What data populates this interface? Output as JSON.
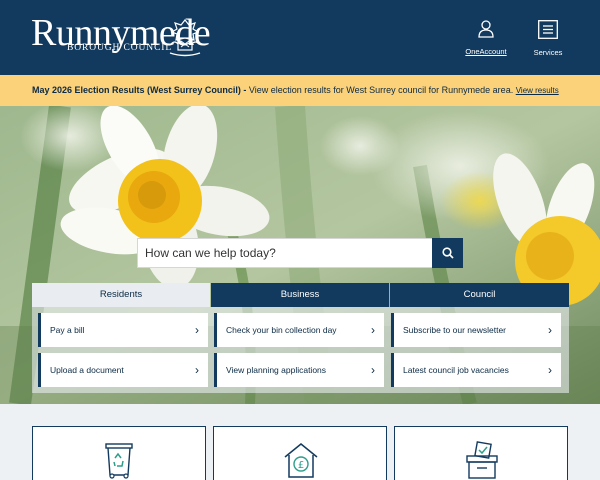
{
  "header": {
    "logo_title": "Runnymede",
    "logo_subtitle": "BOROUGH COUNCIL",
    "nav": [
      {
        "label": "OneAccount",
        "icon": "user-icon"
      },
      {
        "label": "Services",
        "icon": "menu-icon"
      }
    ]
  },
  "banner": {
    "title": "May 2026 Election Results (West Surrey Council) -",
    "text": " View election results for West Surrey council for Runnymede area.",
    "link": "View results"
  },
  "search": {
    "placeholder": "How can we help today?",
    "icon": "search-icon"
  },
  "tabs": [
    {
      "label": "Residents",
      "active": true
    },
    {
      "label": "Business",
      "active": false
    },
    {
      "label": "Council",
      "active": false
    }
  ],
  "quick_links": [
    {
      "label": "Pay a bill"
    },
    {
      "label": "Check your bin collection day"
    },
    {
      "label": "Subscribe to our newsletter"
    },
    {
      "label": "Upload a document"
    },
    {
      "label": "View planning applications"
    },
    {
      "label": "Latest council job vacancies"
    }
  ],
  "tiles": [
    {
      "icon": "recycling-bin-icon"
    },
    {
      "icon": "council-tax-house-icon"
    },
    {
      "icon": "ballot-box-icon"
    }
  ],
  "colors": {
    "primary": "#123a5e",
    "banner": "#fbd17a",
    "background": "#eef1f4"
  }
}
